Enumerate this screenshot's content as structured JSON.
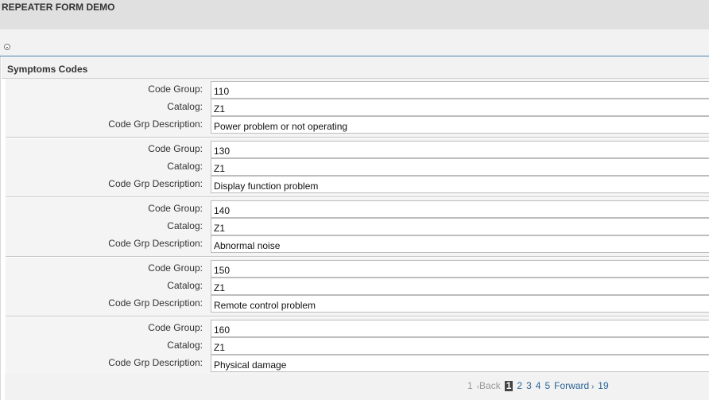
{
  "window": {
    "title": "REPEATER FORM DEMO"
  },
  "section": {
    "title": "Symptoms Codes"
  },
  "labels": {
    "code_group": "Code Group:",
    "catalog": "Catalog:",
    "description": "Code Grp Description:"
  },
  "records": [
    {
      "code_group": "110",
      "catalog": "Z1",
      "description": "Power problem or not operating"
    },
    {
      "code_group": "130",
      "catalog": "Z1",
      "description": "Display function problem"
    },
    {
      "code_group": "140",
      "catalog": "Z1",
      "description": "Abnormal noise"
    },
    {
      "code_group": "150",
      "catalog": "Z1",
      "description": "Remote control problem"
    },
    {
      "code_group": "160",
      "catalog": "Z1",
      "description": "Physical damage"
    }
  ],
  "pager": {
    "first": "1",
    "back": "Back",
    "current": "1",
    "pages": [
      "2",
      "3",
      "4",
      "5"
    ],
    "forward": "Forward",
    "last": "19"
  }
}
